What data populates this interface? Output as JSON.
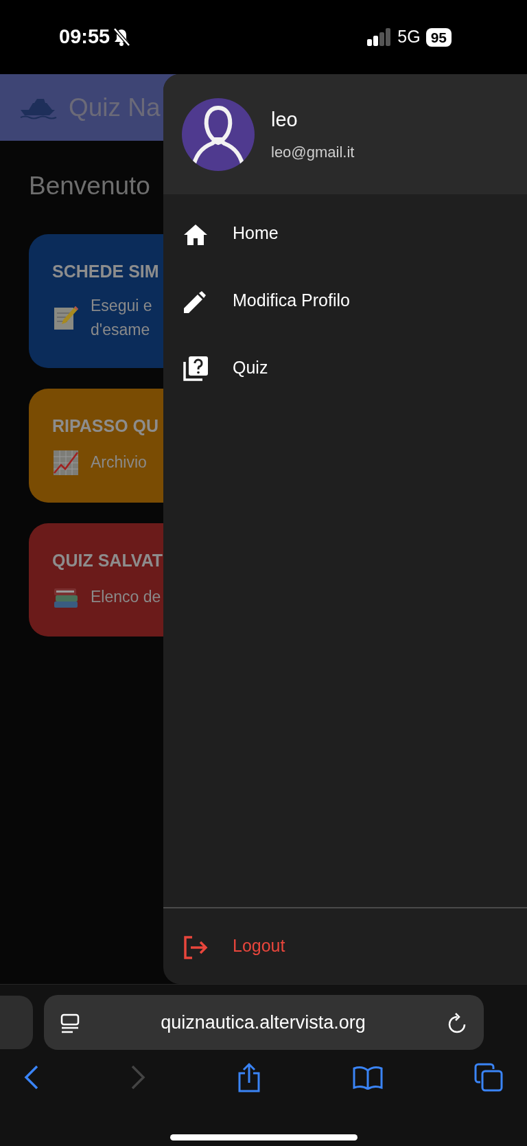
{
  "status_bar": {
    "time": "09:55",
    "network": "5G",
    "battery": "95"
  },
  "app_bar": {
    "title": "Quiz Na"
  },
  "page": {
    "heading": "Benvenuto",
    "cards": [
      {
        "kind": "notes",
        "title": "SCHEDE SIM",
        "lines": [
          "Esegui e",
          "d'esame"
        ],
        "color": "#0b2c5a"
      },
      {
        "kind": "chart",
        "title": "RIPASSO QU",
        "lines": [
          "Archivio"
        ],
        "color": "#7a4c03"
      },
      {
        "kind": "books",
        "title": "QUIZ SALVAT",
        "lines": [
          "Elenco de"
        ],
        "color": "#6b1b1a"
      }
    ]
  },
  "drawer": {
    "user": {
      "name": "leo",
      "email": "leo@gmail.it"
    },
    "items": [
      {
        "kind": "home",
        "label": "Home"
      },
      {
        "kind": "edit",
        "label": "Modifica Profilo"
      },
      {
        "kind": "quiz",
        "label": "Quiz"
      }
    ],
    "logout": "Logout"
  },
  "browser": {
    "url": "quiznautica.altervista.org",
    "forward_disabled": true
  }
}
